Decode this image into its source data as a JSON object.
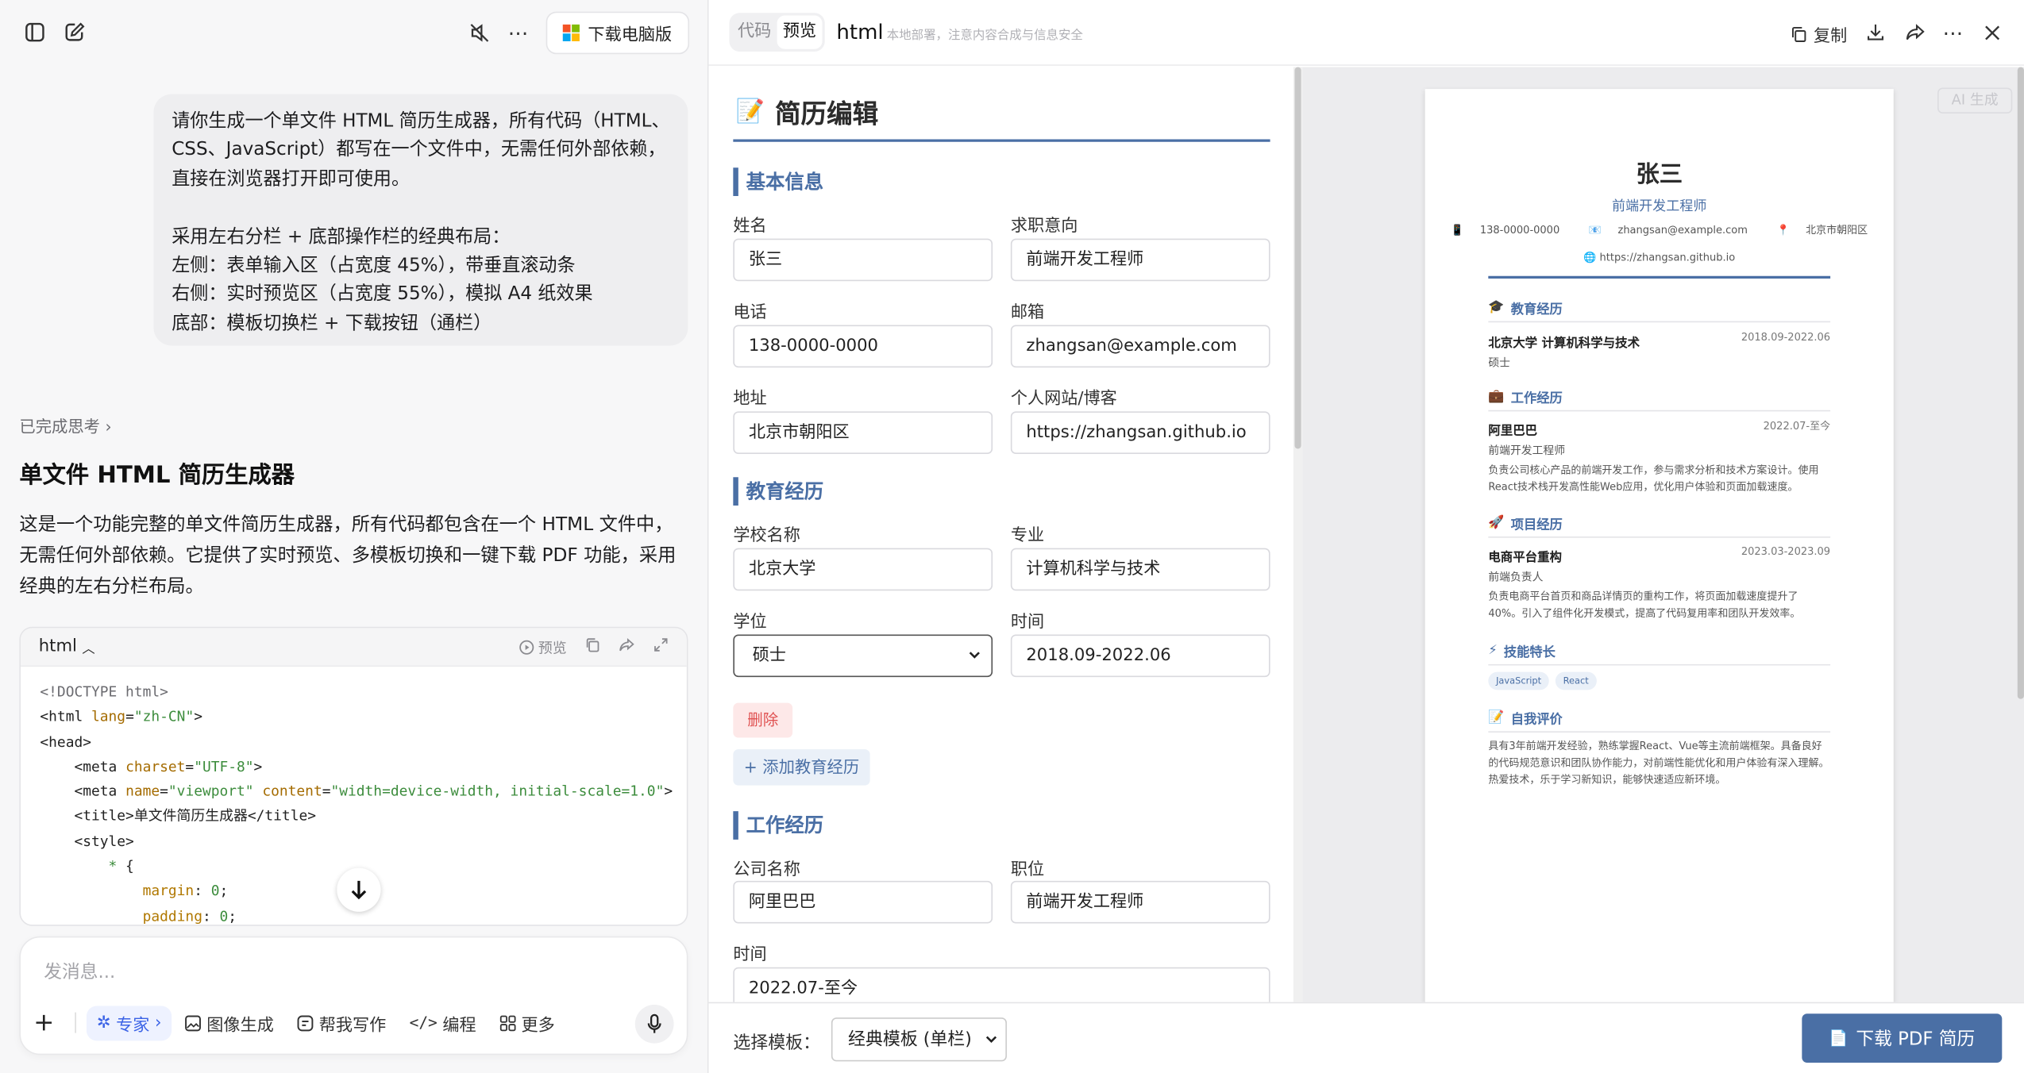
{
  "left_pane": {
    "download_desktop_label": "下载电脑版",
    "user_message": "请你生成一个单文件 HTML 简历生成器，所有代码（HTML、CSS、JavaScript）都写在一个文件中，无需任何外部依赖，直接在浏览器打开即可使用。\n\n采用左右分栏 + 底部操作栏的经典布局：\n左侧：表单输入区（占宽度 45%），带垂直滚动条\n右侧：实时预览区（占宽度 55%），模拟 A4 纸效果\n底部：模板切换栏 + 下载按钮（通栏）",
    "thinking_label": "已完成思考",
    "answer_title": "单文件 HTML 简历生成器",
    "answer_paragraph": "这是一个功能完整的单文件简历生成器，所有代码都包含在一个 HTML 文件中，无需任何外部依赖。它提供了实时预览、多模板切换和一键下载 PDF 功能，采用经典的左右分栏布局。",
    "code_block": {
      "language": "html",
      "preview_label": "预览",
      "lines": [
        "<!DOCTYPE html>",
        "<html lang=\"zh-CN\">",
        "<head>",
        "    <meta charset=\"UTF-8\">",
        "    <meta name=\"viewport\" content=\"width=device-width, initial-scale=1.0\">",
        "    <title>单文件简历生成器</title>",
        "    <style>",
        "        * {",
        "            margin: 0;",
        "            padding: 0;"
      ]
    },
    "input": {
      "placeholder": "发消息...",
      "chips": {
        "expert": "专家",
        "image": "图像生成",
        "writing": "帮我写作",
        "coding": "编程",
        "more": "更多"
      }
    }
  },
  "right_pane": {
    "tabs": {
      "code": "代码",
      "preview": "预览"
    },
    "title": "html",
    "note": "本地部署，注意内容合成与信息安全",
    "copy_label": "复制",
    "ai_label": "AI 生成"
  },
  "form": {
    "heading": "简历编辑",
    "basic": {
      "title": "基本信息",
      "name_label": "姓名",
      "name_value": "张三",
      "job_label": "求职意向",
      "job_value": "前端开发工程师",
      "phone_label": "电话",
      "phone_value": "138-0000-0000",
      "email_label": "邮箱",
      "email_value": "zhangsan@example.com",
      "addr_label": "地址",
      "addr_value": "北京市朝阳区",
      "site_label": "个人网站/博客",
      "site_value": "https://zhangsan.github.io"
    },
    "edu": {
      "title": "教育经历",
      "school_label": "学校名称",
      "school_value": "北京大学",
      "major_label": "专业",
      "major_value": "计算机科学与技术",
      "degree_label": "学位",
      "degree_value": "硕士",
      "time_label": "时间",
      "time_value": "2018.09-2022.06",
      "delete_label": "删除",
      "add_label": "+ 添加教育经历"
    },
    "work": {
      "title": "工作经历",
      "company_label": "公司名称",
      "company_value": "阿里巴巴",
      "position_label": "职位",
      "position_value": "前端开发工程师",
      "time_label": "时间",
      "time_value": "2022.07-至今"
    }
  },
  "preview": {
    "name": "张三",
    "job": "前端开发工程师",
    "phone": "138-0000-0000",
    "email": "zhangsan@example.com",
    "address": "北京市朝阳区",
    "website": "https://zhangsan.github.io",
    "edu_title": "教育经历",
    "edu_school": "北京大学 计算机科学与技术",
    "edu_date": "2018.09-2022.06",
    "edu_degree": "硕士",
    "work_title": "工作经历",
    "work_company": "阿里巴巴",
    "work_date": "2022.07-至今",
    "work_position": "前端开发工程师",
    "work_desc": "负责公司核心产品的前端开发工作，参与需求分析和技术方案设计。使用React技术栈开发高性能Web应用，优化用户体验和页面加载速度。",
    "project_title": "项目经历",
    "project_name": "电商平台重构",
    "project_date": "2023.03-2023.09",
    "project_role": "前端负责人",
    "project_desc": "负责电商平台首页和商品详情页的重构工作，将页面加载速度提升了40%。引入了组件化开发模式，提高了代码复用率和团队开发效率。",
    "skills_title": "技能特长",
    "skills": [
      "JavaScript",
      "React"
    ],
    "self_title": "自我评价",
    "self_desc": "具有3年前端开发经验，熟练掌握React、Vue等主流前端框架。具备良好的代码规范意识和团队协作能力，对前端性能优化和用户体验有深入理解。热爱技术，乐于学习新知识，能够快速适应新环境。"
  },
  "bottom_bar": {
    "template_label": "选择模板：",
    "template_value": "经典模板 (单栏)",
    "download_pdf_label": "下载 PDF 简历"
  },
  "colors": {
    "accent": "#4a6fa5",
    "danger": "#e05252",
    "expert_chip": "#3b63e6"
  }
}
